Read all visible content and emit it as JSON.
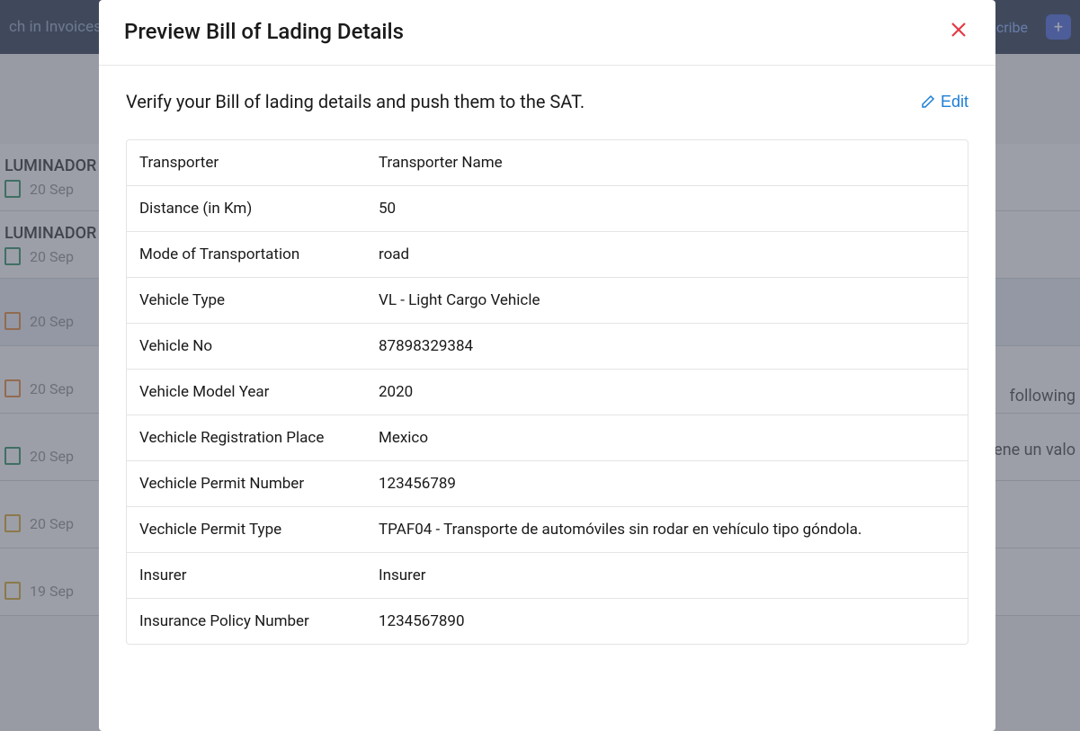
{
  "background": {
    "search_placeholder": "ch in Invoices",
    "subscribe": "cribe",
    "items": [
      {
        "title": "LUMINADOR",
        "date": "20 Sep",
        "icon_color": "green"
      },
      {
        "title": "LUMINADOR",
        "date": "20 Sep",
        "icon_color": "green"
      },
      {
        "title": "",
        "date": "20 Sep",
        "icon_color": "orange"
      },
      {
        "title": "",
        "date": "20 Sep",
        "icon_color": "orange"
      },
      {
        "title": "",
        "date": "20 Sep",
        "icon_color": "green"
      },
      {
        "title": "",
        "date": "20 Sep",
        "icon_color": "yellow"
      },
      {
        "title": "",
        "date": "19 Sep",
        "icon_color": "yellow"
      }
    ],
    "right_text1": "following",
    "right_text2": "iene un valo"
  },
  "modal": {
    "title": "Preview Bill of Lading Details",
    "subtitle": "Verify your Bill of lading details and push them to the SAT.",
    "edit_label": "Edit",
    "rows": [
      {
        "label": "Transporter",
        "value": "Transporter Name"
      },
      {
        "label": "Distance (in Km)",
        "value": "50"
      },
      {
        "label": "Mode of Transportation",
        "value": "road"
      },
      {
        "label": "Vehicle Type",
        "value": "VL - Light Cargo Vehicle"
      },
      {
        "label": "Vehicle No",
        "value": "87898329384"
      },
      {
        "label": "Vehicle Model Year",
        "value": "2020"
      },
      {
        "label": "Vechicle Registration Place",
        "value": "Mexico"
      },
      {
        "label": "Vechicle Permit Number",
        "value": "123456789"
      },
      {
        "label": "Vechicle Permit Type",
        "value": "TPAF04 - Transporte de automóviles sin rodar en vehículo tipo góndola."
      },
      {
        "label": "Insurer",
        "value": "Insurer"
      },
      {
        "label": "Insurance Policy Number",
        "value": "1234567890"
      }
    ]
  }
}
